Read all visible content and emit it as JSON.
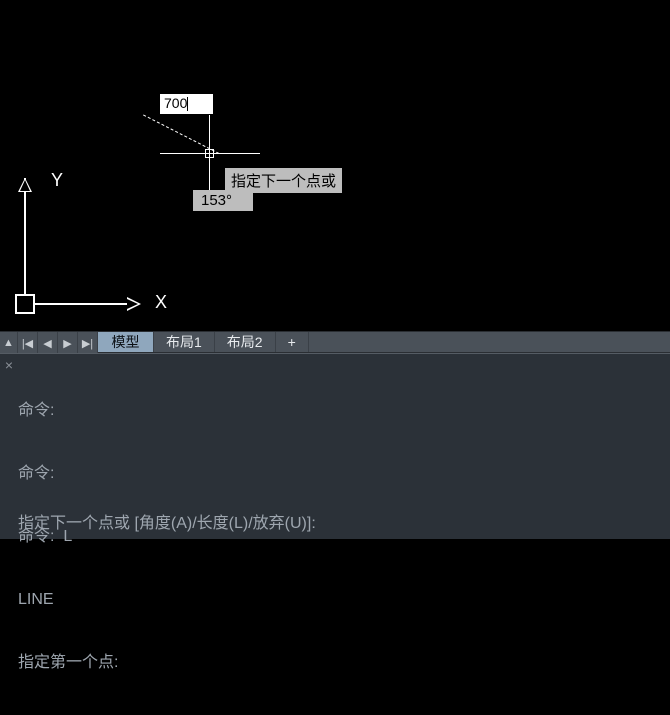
{
  "ucs": {
    "x_label": "X",
    "y_label": "Y"
  },
  "dynamic_input": {
    "length_value": "700",
    "tooltip": "指定下一个点或",
    "angle_value": "153°"
  },
  "tabs": {
    "nav": {
      "up": "▲",
      "first": "|◀",
      "prev": "◀",
      "next": "▶",
      "last": "▶|"
    },
    "items": [
      {
        "label": "模型",
        "active": true
      },
      {
        "label": "布局1",
        "active": false
      },
      {
        "label": "布局2",
        "active": false
      }
    ],
    "plus": "+"
  },
  "command": {
    "close": "×",
    "history": [
      "命令:",
      "命令:",
      "命令:  L",
      "LINE",
      "指定第一个点:"
    ],
    "prompt": "指定下一个点或 [角度(A)/长度(L)/放弃(U)]:"
  }
}
